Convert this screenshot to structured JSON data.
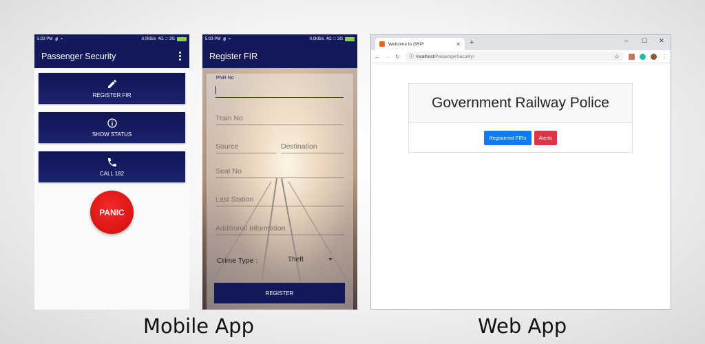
{
  "phone1": {
    "status": {
      "time": "5:03 PM",
      "carrier_icon": "g",
      "net": "0.0KB/s",
      "bars": "4G ::: 3G"
    },
    "title": "Passenger Security",
    "buttons": [
      {
        "label": "REGISTER FIR",
        "icon": "pencil-icon"
      },
      {
        "label": "SHOW STATUS",
        "icon": "info-icon"
      },
      {
        "label": "CALL 182",
        "icon": "phone-icon"
      }
    ],
    "panic_label": "PANIC",
    "colors": {
      "primary": "#13195a",
      "panic": "#e01414"
    }
  },
  "phone2": {
    "status": {
      "time": "5:03 PM",
      "carrier_icon": "g",
      "net": "0.0KB/s",
      "bars": "4G ::: 3G"
    },
    "title": "Register FIR",
    "fields": {
      "pnr": "PNR No",
      "train": "Train No",
      "source": "Source",
      "destination": "Destination",
      "seat": "Seat No",
      "last_station": "Last Station",
      "additional": "Additional Information"
    },
    "crime_type_label": "Crime Type :",
    "crime_type_value": "Theft",
    "register_label": "REGISTER"
  },
  "browser": {
    "tab_title": "Welcome to GRP!",
    "url_host": "localhost",
    "url_path": "/PassengerSecurity/",
    "heading": "Government Railway Police",
    "btn_firs": "Registered FIRs",
    "btn_alerts": "Alerts",
    "colors": {
      "primary_btn": "#0d7bf2",
      "danger_btn": "#dc3545"
    }
  },
  "captions": {
    "mobile": "Mobile App",
    "web": "Web App"
  }
}
